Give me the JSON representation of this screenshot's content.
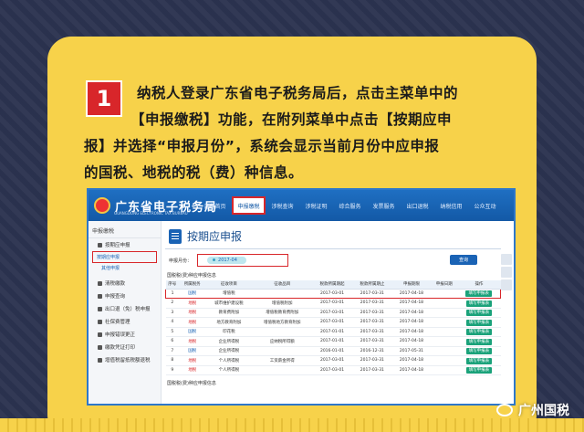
{
  "step": {
    "number": "1",
    "lines": [
      "纳税人登录广东省电子税务局后，点击主菜单中的",
      "【申报缴税】功能，在附列菜单中点击【按期应申",
      "报】并选择“申报月份”，系统会显示当前月份中应申报",
      "的国税、地税的税（费）种信息。"
    ]
  },
  "site": {
    "title": "广东省电子税务局",
    "subtitle": "GUANGDONG ELECTRONIC TAX BUREAU",
    "nav": [
      "办税首页",
      "申报缴税",
      "涉税查询",
      "涉税证明",
      "综合服务",
      "发票服务",
      "出口退税",
      "纳税信用",
      "公众互动"
    ]
  },
  "sidebar": {
    "header": "申报缴税",
    "items": [
      {
        "label": "按期应申报",
        "subs": [
          "按期应申报",
          "其他申报"
        ]
      },
      {
        "label": "清税缴款"
      },
      {
        "label": "申报查询"
      },
      {
        "label": "出口退（免）税申报"
      },
      {
        "label": "社保费管理"
      },
      {
        "label": "申报错误更正"
      },
      {
        "label": "缴款凭证打印"
      },
      {
        "label": "增值税留抵税额退税"
      }
    ]
  },
  "main": {
    "title": "按期应申报",
    "filter_label": "申报月份：",
    "month_value": "2017-04",
    "query_button": "查询",
    "section_title": "国税税(费)种应申报信息",
    "columns": [
      "序号",
      "所属税务",
      "征收项目",
      "征收品目",
      "税款所属期起",
      "税款所属期止",
      "申报期限",
      "申报日期",
      "操作"
    ],
    "rows": [
      [
        "1",
        "国税",
        "增值税",
        "",
        "2017-03-01",
        "2017-03-31",
        "2017-04-18",
        "",
        "填写申报表"
      ],
      [
        "2",
        "地税",
        "城市维护建设税",
        "增值税附加",
        "2017-03-01",
        "2017-03-31",
        "2017-04-18",
        "",
        "填写申报表"
      ],
      [
        "3",
        "地税",
        "教育费附加",
        "增值税教育费附加",
        "2017-03-01",
        "2017-03-31",
        "2017-04-18",
        "",
        "填写申报表"
      ],
      [
        "4",
        "地税",
        "地方教育附加",
        "增值税地方教育附加",
        "2017-03-01",
        "2017-03-31",
        "2017-04-18",
        "",
        "填写申报表"
      ],
      [
        "5",
        "国税",
        "印花税",
        "",
        "2017-01-01",
        "2017-03-31",
        "2017-04-18",
        "",
        "填写申报表"
      ],
      [
        "6",
        "地税",
        "企业所得税",
        "应纳税所得额",
        "2017-01-01",
        "2017-03-31",
        "2017-04-18",
        "",
        "填写申报表"
      ],
      [
        "7",
        "国税",
        "企业所得税",
        "",
        "2016-01-01",
        "2016-12-31",
        "2017-05-31",
        "",
        "填写申报表"
      ],
      [
        "8",
        "地税",
        "个人所得税",
        "工资薪金所得",
        "2017-03-01",
        "2017-03-31",
        "2017-04-18",
        "",
        "填写申报表"
      ],
      [
        "9",
        "地税",
        "个人所得税",
        "",
        "2017-03-01",
        "2017-03-31",
        "2017-04-18",
        "",
        "填写申报表"
      ]
    ],
    "section2_title": "国税税(费)种应申报信息"
  },
  "watermark": "广州国税",
  "colors": {
    "card": "#f7d24a",
    "badge": "#d8262a",
    "header": "#1359a6",
    "highlight": "#d8262a"
  }
}
